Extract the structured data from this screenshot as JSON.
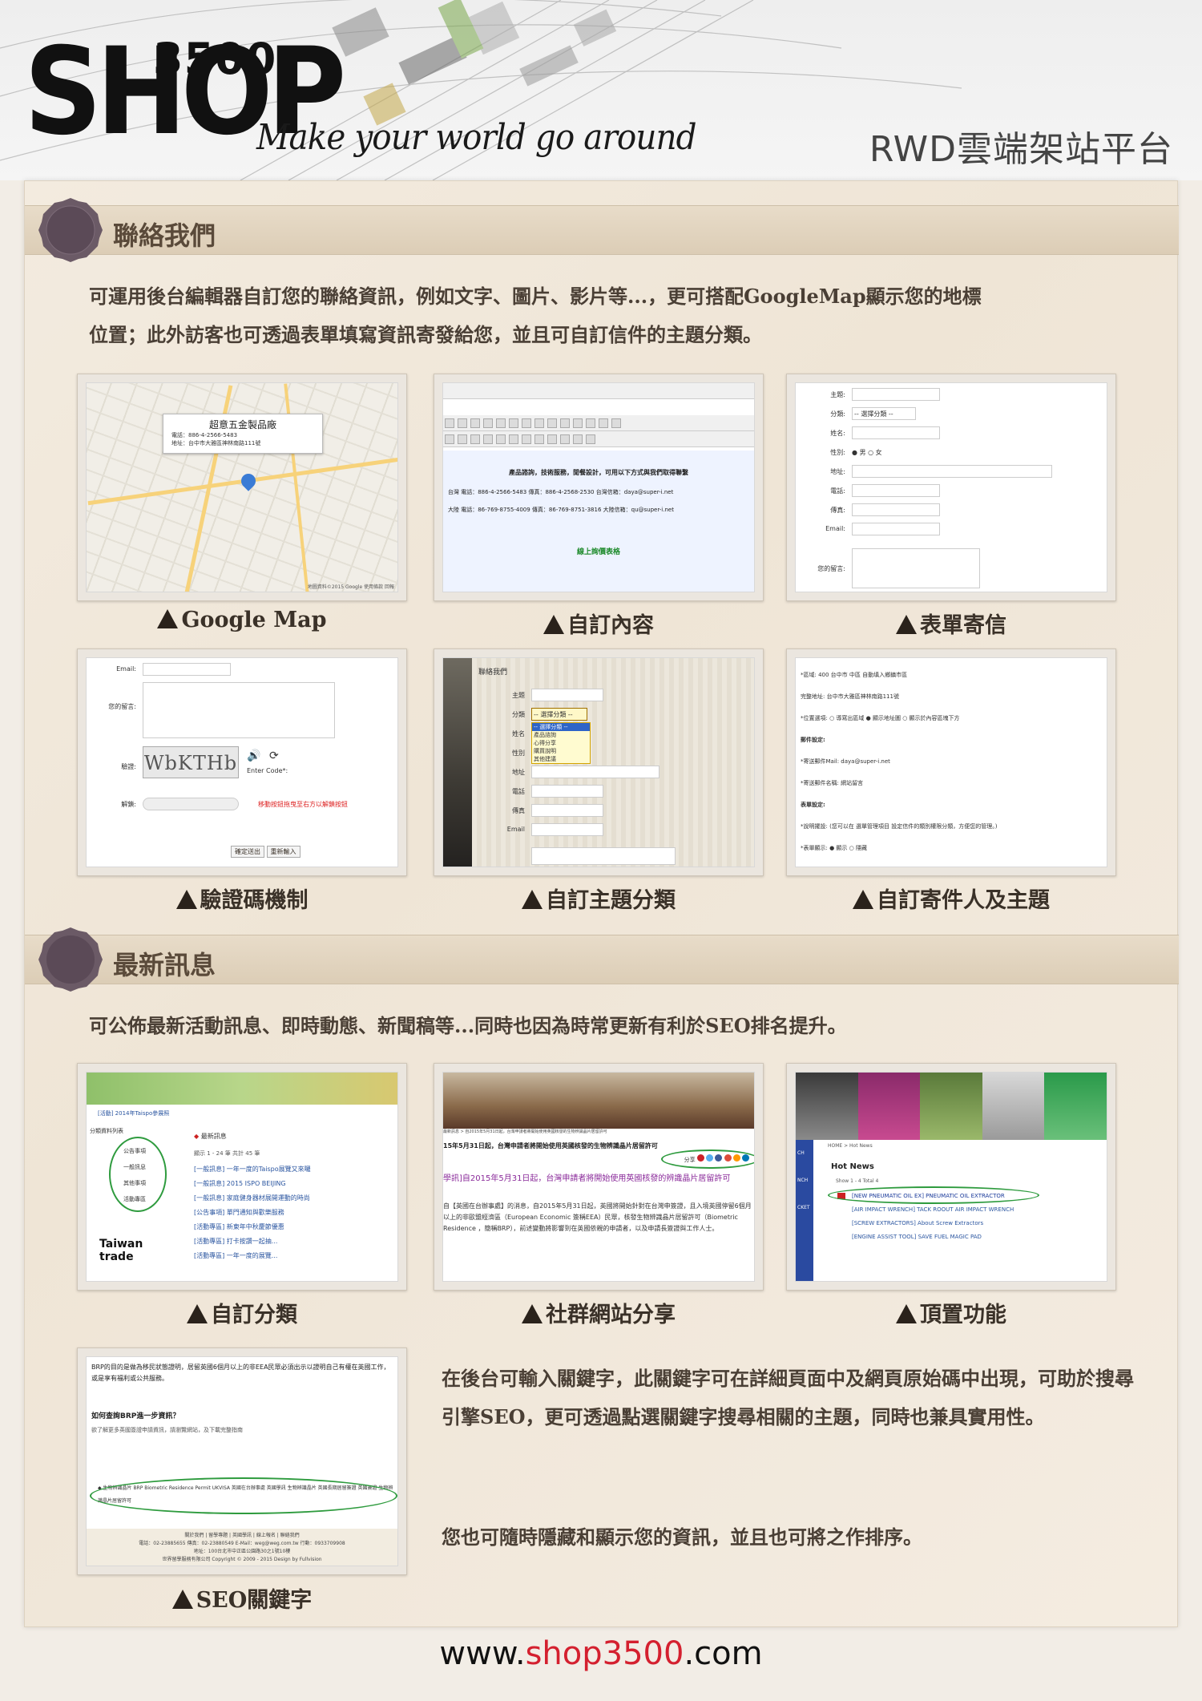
{
  "header": {
    "logo_number": "3500",
    "logo_word": "SHOP",
    "tagline": "Make your world go around",
    "platform_title": "RWD雲端架站平台"
  },
  "section_contact": {
    "title": "聯絡我們",
    "description_line1": "可運用後台編輯器自訂您的聯絡資訊，例如文字、圖片、影片等...，更可搭配GoogleMap顯示您的地標",
    "description_line2": "位置；此外訪客也可透過表單填寫資訊寄發給您，並且可自訂信件的主題分類。",
    "thumbnails": [
      {
        "caption": "Google Map",
        "map_popup_title": "超意五金製品廠",
        "map_popup_phone": "電話：886-4-2566-5483",
        "map_popup_addr": "地址：台中市大雅區神林南路111號",
        "map_attribution": "地圖資料©2015 Google  使用條款  回報"
      },
      {
        "caption": "自訂內容",
        "editor_heading": "產品諮詢，技術服務，閒餐設計，可用以下方式與我們取得聯繫",
        "row1": "台灣  電話：886-4-2566-5483    傳真：886-4-2568-2530   台灣信箱：daya@super-i.net",
        "row2": "大陸  電話：86-769-8755-4009   傳真：86-769-8751-3816   大陸信箱：qu@super-i.net",
        "link": "線上詢價表格"
      },
      {
        "caption": "表單寄信",
        "fields": [
          "主題:",
          "分類:",
          "姓名:",
          "性別:",
          "地址:",
          "電話:",
          "傳真:",
          "Email:",
          "您的留言:"
        ],
        "select_placeholder": "-- 選擇分類 --",
        "gender_options": "● 男 ○ 女"
      },
      {
        "caption": "驗證碼機制",
        "email_label": "Email:",
        "message_label": "您的留言:",
        "captcha_label": "驗證:",
        "captcha_text": "WbKTHb",
        "captcha_hint": "Enter Code*:",
        "unlock_label": "解鎖:",
        "unlock_hint": "移動按鈕拖曳至右方以解鎖按鈕",
        "submit": "確定送出",
        "reset": "重新輸入"
      },
      {
        "caption": "自訂主題分類",
        "page_label": "聯絡我們",
        "dropdown_head": "-- 選擇分類 --",
        "dropdown_items": [
          "-- 選擇分類 --",
          "產品諮詢",
          "心得分享",
          "購買說明",
          "其他建議"
        ],
        "fields": [
          "主題",
          "分類",
          "姓名",
          "性別",
          "地址",
          "電話",
          "傳真",
          "Email"
        ]
      },
      {
        "caption": "自訂寄件人及主題",
        "rows": [
          "*區域:  400   台中市   中區   自動填入鄉鎮市區",
          "完整地址:  台中市大雅區神林南路111號",
          "*位置選項: ○ 導寫出區域 ● 顯示地址圖 ○ 顯示於內容區塊下方",
          "郵件設定:",
          "*寄送郵件Mail:  daya@super-i.net",
          "*寄送郵件名稱:  網站留言",
          "表單設定:",
          "*說明擺設:  (您可以在 選單管理項目 設定信件的類別權限分類，方便您的管理。)",
          "*表單顯示: ● 顯示 ○ 隱藏"
        ]
      }
    ]
  },
  "section_news": {
    "title": "最新訊息",
    "description": "可公佈最新活動訊息、即時動態、新聞稿等...同時也因為時常更新有利於SEO排名提升。",
    "thumbnails": [
      {
        "caption": "自訂分類",
        "breadcrumb": "[活動] 2014年Taispo參展照",
        "sidebar_head": "分類資料列表",
        "sidebar_items": [
          "公告事項",
          "一般訊息",
          "其他事項",
          "活動專區"
        ],
        "list_head": "最新訊息",
        "list_count": "顯示 1 - 24 筆 共計 45 筆",
        "list_items": [
          "[一般訊息] 一年一度的Taispo展覽又來囉",
          "[一般訊息] 2015 ISPO BEIJING",
          "[一般訊息] 家庭健身器材展開運動的時尚",
          "[公告事項] 單門通知與歡樂服務",
          "[活動專區] 新東年中秋慶節優惠",
          "[活動專區] 打卡按讚一起抽...",
          "[活動專區] 一年一度的展覽..."
        ],
        "promo": "Taiwan trade"
      },
      {
        "caption": "社群網站分享",
        "breadcrumb": "最新訊息 > 自2015年5月31日起，台灣申請者將開始使用英國核發的生物辨識晶片居留許可",
        "headline": "15年5月31日起，台灣申請者將開始使用英國核發的生物辨識晶片居留許可",
        "share_label": "分享",
        "title_purple": "學訊]自2015年5月31日起，台灣申請者將開始使用英國核發的辨識晶片居留許可",
        "body": "自【英國在台辦事處】的消息，自2015年5月31日起，英國將開始針對在台灣申簽證，且入境英國停留6個月以上的非歐盟經濟區（European Economic 簽稱EEA）民眾，核發生物辨識晶片居留許可（Biometric Residence ，簡稱BRP），前述變動將影響到在英國依親的申請者，以及申請長簽證與工作人士。"
      },
      {
        "caption": "頂置功能",
        "breadcrumb": "HOME > Hot News",
        "heading": "Hot News",
        "count": "Show 1 - 4 Total 4",
        "items": [
          "[NEW PNEUMATIC OIL EX] PNEUMATIC OIL EXTRACTOR",
          "[AIR IMPACT WRENCH] TACK ROOUT AIR IMPACT WRENCH",
          "[SCREW EXTRACTORS] About Screw Extractors",
          "[ENGINE ASSIST TOOL] SAVE FUEL MAGIC PAD"
        ],
        "side_tabs": [
          "CH",
          "NCH",
          "CKET"
        ]
      },
      {
        "caption": "SEO關鍵字",
        "text1": "BRP的目的是做為移民狀態證明，居留英國6個月以上的非EEA民眾必須出示以證明自己有權在英國工作，或是享有福利或公共服務。",
        "question": "如何查詢BRP進一步資訊？",
        "answer": "欲了解更多英國簽證申請資訊，請瀏覽網站，及下載完整指南",
        "keywords": "生物辨識晶片   BRP   Biometric Residence Permit   UKVISA   英國在台辦事處   英國學訊   生物辨識晶片   英國長期居留簽證   英國簽證   生物辨識晶片居留許可",
        "footer_links": "關於我們 | 留學專題 | 英國學訊 | 線上報名 | 聯絡我們",
        "footer_tel": "電話：02-23885655  傳真：02-23880549  E-Mail：weg@weg.com.tw  行動：0933709908",
        "footer_addr": "地址：100台北市中正區公園路30之1號10樓",
        "footer_copy": "世界留學服務有限公司 Copyright © 2009 - 2015 Design by Fullvision"
      }
    ],
    "seo_text": "在後台可輸入關鍵字，此關鍵字可在詳細頁面中及網頁原始碼中出現，可助於搜尋引擎SEO，更可透過點選關鍵字搜尋相關的主題，同時也兼具實用性。",
    "order_text": "您也可隨時隱藏和顯示您的資訊，並且也可將之作排序。"
  },
  "footer": {
    "url_prefix": "www.",
    "url_brand": "shop3500",
    "url_suffix": ".com"
  },
  "colors": {
    "band": "#dccdb6",
    "title": "#5a4a3a",
    "accent_red": "#d4202f",
    "ring_green": "#2e9b3e"
  }
}
